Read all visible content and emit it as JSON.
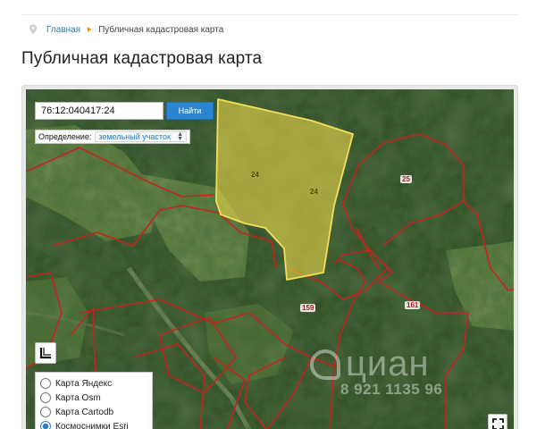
{
  "breadcrumb": {
    "home": "Главная",
    "current": "Публичная кадастровая карта"
  },
  "page": {
    "title": "Публичная кадастровая карта"
  },
  "search": {
    "value": "76:12:040417:24",
    "button_label": "Найти"
  },
  "definition": {
    "label": "Определение:",
    "selected": "земельный участок"
  },
  "basemaps": [
    {
      "label": "Карта Яндекс",
      "selected": false
    },
    {
      "label": "Карта Osm",
      "selected": false
    },
    {
      "label": "Карта Cartodb",
      "selected": false
    },
    {
      "label": "Космоснимки Esri",
      "selected": true
    }
  ],
  "plots": {
    "yellow_a": "24",
    "yellow_b": "24",
    "red_25": "25",
    "red_159": "159",
    "red_161": "161"
  },
  "watermark": {
    "brand": "циан",
    "phone": "8 921 1135 96"
  },
  "colors": {
    "link": "#2a7bbf",
    "button": "#2b86d1",
    "highlight_fill": "#e6d34a",
    "boundary": "#c4241f",
    "breadcrumb_arrow": "#f28a1a"
  }
}
